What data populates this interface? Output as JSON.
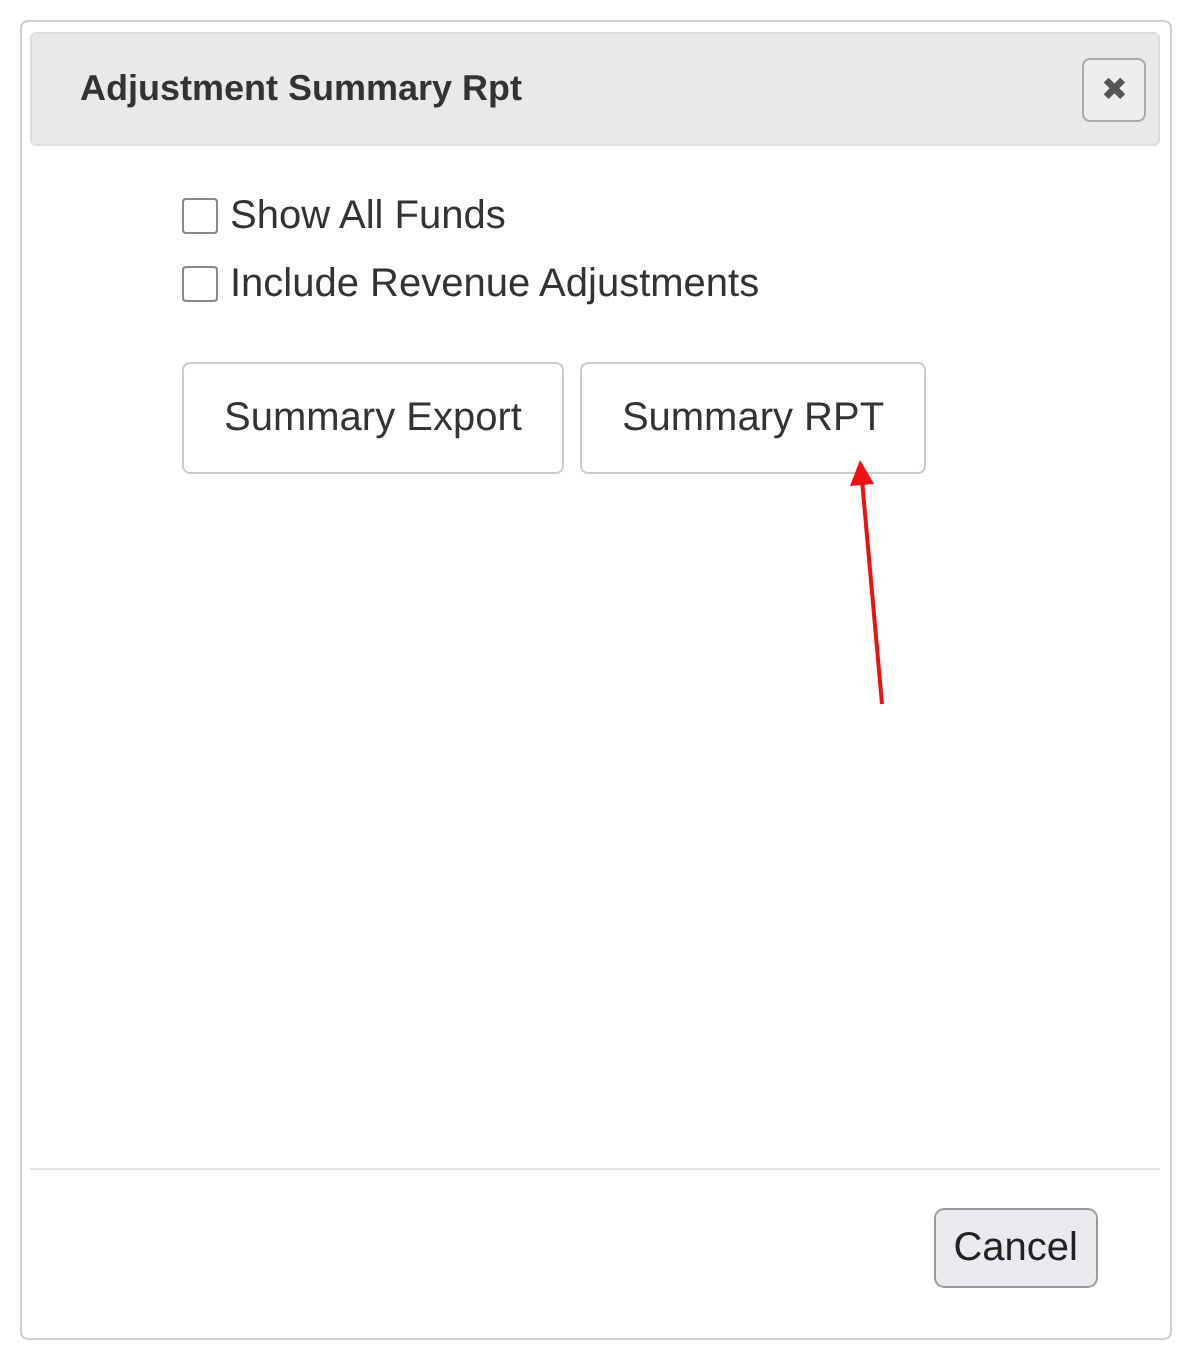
{
  "dialog": {
    "title": "Adjustment Summary Rpt",
    "close": "✖",
    "options": [
      {
        "label": "Show All Funds",
        "checked": false
      },
      {
        "label": "Include Revenue Adjustments",
        "checked": false
      }
    ],
    "actions": [
      "Summary Export",
      "Summary RPT"
    ],
    "footer_buttons": [
      "Cancel"
    ]
  }
}
